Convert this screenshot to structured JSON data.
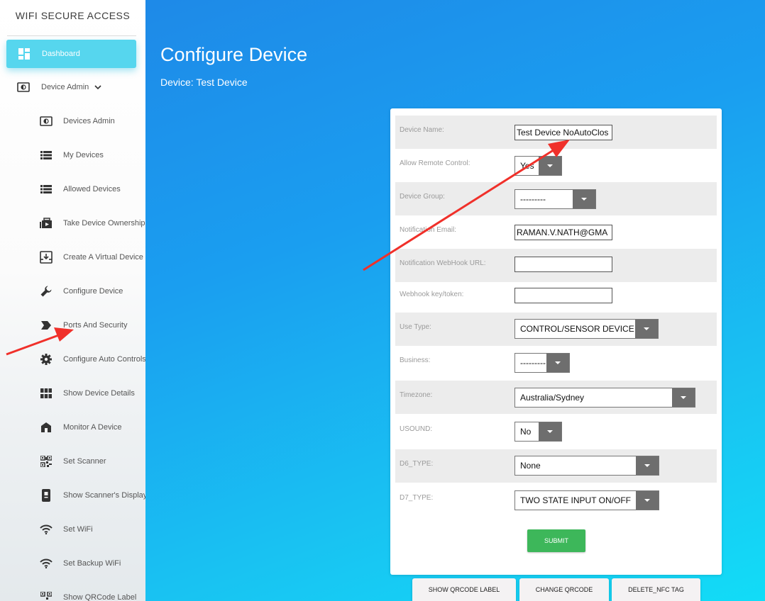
{
  "sidebar": {
    "brand": "WIFI SECURE ACCESS",
    "dashboard": {
      "label": "Dashboard",
      "icon": "dashboard-icon"
    },
    "device_admin": {
      "label": "Device Admin",
      "icon": "device-admin-icon"
    },
    "items": [
      {
        "label": "Devices Admin",
        "icon": "devices-admin-icon"
      },
      {
        "label": "My Devices",
        "icon": "list-icon"
      },
      {
        "label": "Allowed Devices",
        "icon": "list-icon"
      },
      {
        "label": "Take Device Ownership",
        "icon": "ownership-icon"
      },
      {
        "label": "Create A Virtual Device",
        "icon": "download-box-icon"
      },
      {
        "label": "Configure Device",
        "icon": "wrench-icon"
      },
      {
        "label": "Ports And Security",
        "icon": "label-tag-icon"
      },
      {
        "label": "Configure Auto Controls",
        "icon": "gear-icon"
      },
      {
        "label": "Show Device Details",
        "icon": "grid-icon"
      },
      {
        "label": "Monitor A Device",
        "icon": "home-icon"
      },
      {
        "label": "Set Scanner",
        "icon": "qrcode-icon"
      },
      {
        "label": "Show Scanner's Display",
        "icon": "display-device-icon"
      },
      {
        "label": "Set WiFi",
        "icon": "wifi-icon"
      },
      {
        "label": "Set Backup WiFi",
        "icon": "wifi-icon"
      },
      {
        "label": "Show QRCode Label",
        "icon": "qrcode-icon"
      }
    ]
  },
  "header": {
    "title": "Configure Device",
    "subtitle": "Device: Test Device"
  },
  "form": {
    "device_name": {
      "label": "Device Name:",
      "value": "Test Device NoAutoClos"
    },
    "allow_remote": {
      "label": "Allow Remote Control:",
      "value": "Yes"
    },
    "device_group": {
      "label": "Device Group:",
      "value": "---------"
    },
    "notification_email": {
      "label": "Notification Email:",
      "value": "RAMAN.V.NATH@GMA"
    },
    "webhook_url": {
      "label": "Notification WebHook URL:",
      "value": ""
    },
    "webhook_key": {
      "label": "Webhook key/token:",
      "value": ""
    },
    "use_type": {
      "label": "Use Type:",
      "value": "CONTROL/SENSOR DEVICE"
    },
    "business": {
      "label": "Business:",
      "value": "---------"
    },
    "timezone": {
      "label": "Timezone:",
      "value": "Australia/Sydney"
    },
    "usound": {
      "label": "USOUND:",
      "value": "No"
    },
    "d6_type": {
      "label": "D6_TYPE:",
      "value": "None"
    },
    "d7_type": {
      "label": "D7_TYPE:",
      "value": "TWO STATE INPUT ON/OFF"
    },
    "submit_label": "SUBMIT"
  },
  "bottom_buttons": {
    "show_qrcode": "SHOW QRCODE LABEL",
    "change_qrcode": "CHANGE QRCODE",
    "delete_nfc": "DELETE_NFC TAG"
  },
  "colors": {
    "accent_dashboard": "#56d6ee",
    "submit_green": "#3db75a",
    "annotation_arrow": "#f0302a"
  }
}
